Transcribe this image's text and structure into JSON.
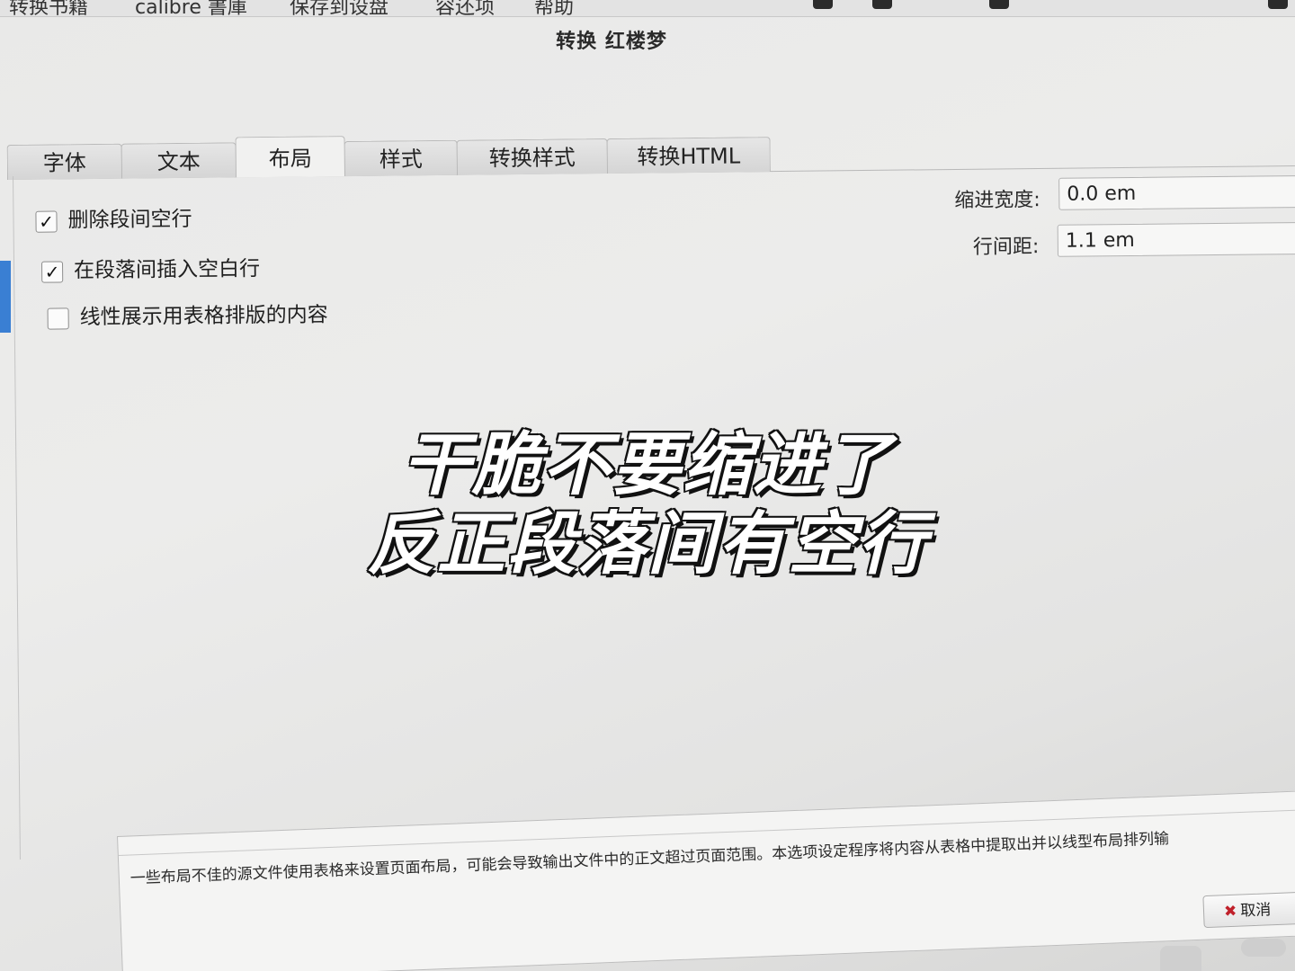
{
  "window": {
    "title": "转换 红楼梦"
  },
  "menubar": {
    "items": [
      "转换书籍",
      "calibre 書庫",
      "保存到设盘",
      "容还项",
      "帮助"
    ]
  },
  "tabs": [
    {
      "label": "字体",
      "active": false
    },
    {
      "label": "文本",
      "active": false
    },
    {
      "label": "布局",
      "active": true
    },
    {
      "label": "样式",
      "active": false
    },
    {
      "label": "转换样式",
      "active": false
    },
    {
      "label": "转换HTML",
      "active": false
    }
  ],
  "layout": {
    "options": [
      {
        "label": "删除段间空行",
        "checked": true
      },
      {
        "label": "在段落间插入空白行",
        "checked": true
      },
      {
        "label": "线性展示用表格排版的内容",
        "checked": false
      }
    ],
    "indent_label": "缩进宽度:",
    "indent_value": "0.0 em",
    "line_spacing_label": "行间距:",
    "line_spacing_value": "1.1 em"
  },
  "help": {
    "text": "一些布局不佳的源文件使用表格来设置页面布局，可能会导致输出文件中的正文超过页面范围。本选项设定程序将内容从表格中提取出并以线型布局排列输"
  },
  "buttons": {
    "cancel_label": "取消",
    "cancel_icon": "✖"
  },
  "caption": {
    "line1": "干脆不要缩进了",
    "line2": "反正段落间有空行"
  },
  "colors": {
    "caption_fill": "#ffffff",
    "caption_stroke": "#111111",
    "cancel_icon": "#c0202a",
    "accent_edge": "#3a7fd3"
  }
}
